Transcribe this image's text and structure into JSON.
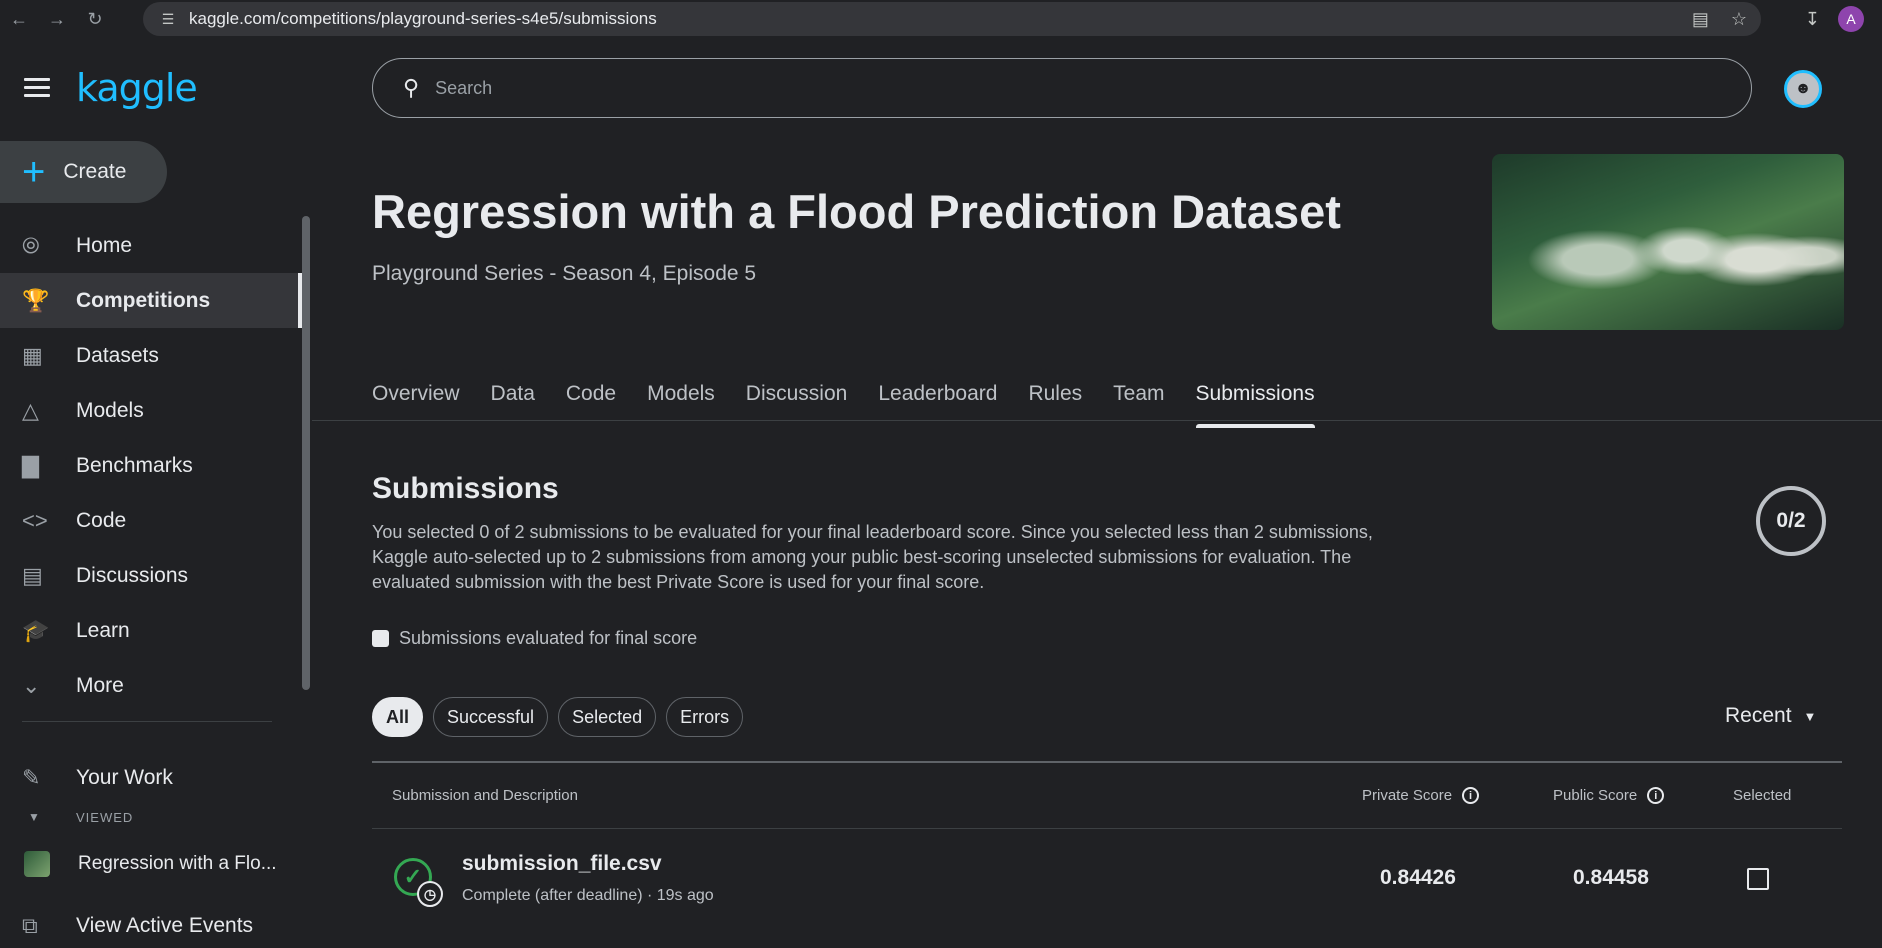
{
  "browser": {
    "url": "kaggle.com/competitions/playground-series-s4e5/submissions",
    "profile_initial": "A"
  },
  "sidebar": {
    "logo": "kaggle",
    "create_label": "Create",
    "items": [
      {
        "label": "Home",
        "icon": "compass-icon"
      },
      {
        "label": "Competitions",
        "icon": "trophy-icon"
      },
      {
        "label": "Datasets",
        "icon": "table-icon"
      },
      {
        "label": "Models",
        "icon": "models-icon"
      },
      {
        "label": "Benchmarks",
        "icon": "bar-chart-icon"
      },
      {
        "label": "Code",
        "icon": "code-icon"
      },
      {
        "label": "Discussions",
        "icon": "comments-icon"
      },
      {
        "label": "Learn",
        "icon": "school-icon"
      },
      {
        "label": "More",
        "icon": "chevron-down-icon"
      }
    ],
    "your_work": "Your Work",
    "viewed_header": "VIEWED",
    "viewed_item": "Regression with a Flo...",
    "view_active_events": "View Active Events"
  },
  "search": {
    "placeholder": "Search"
  },
  "competition": {
    "title": "Regression with a Flood Prediction Dataset",
    "subtitle": "Playground Series - Season 4, Episode 5"
  },
  "tabs": [
    "Overview",
    "Data",
    "Code",
    "Models",
    "Discussion",
    "Leaderboard",
    "Rules",
    "Team",
    "Submissions"
  ],
  "active_tab": "Submissions",
  "submissions": {
    "heading": "Submissions",
    "description": "You selected 0 of 2 submissions to be evaluated for your final leaderboard score. Since you selected less than 2 submissions, Kaggle auto-selected up to 2 submissions from among your public best-scoring unselected submissions for evaluation. The evaluated submission with the best Private Score is used for your final score.",
    "selected_count": "0/2",
    "final_score_checkbox": "Submissions evaluated for final score",
    "filters": [
      "All",
      "Successful",
      "Selected",
      "Errors"
    ],
    "sort_label": "Recent",
    "columns": {
      "submission": "Submission and Description",
      "private": "Private Score",
      "public": "Public Score",
      "selected": "Selected"
    },
    "rows": [
      {
        "file": "submission_file.csv",
        "status": "Complete (after deadline) · 19s ago",
        "private_score": "0.84426",
        "public_score": "0.84458"
      }
    ]
  }
}
